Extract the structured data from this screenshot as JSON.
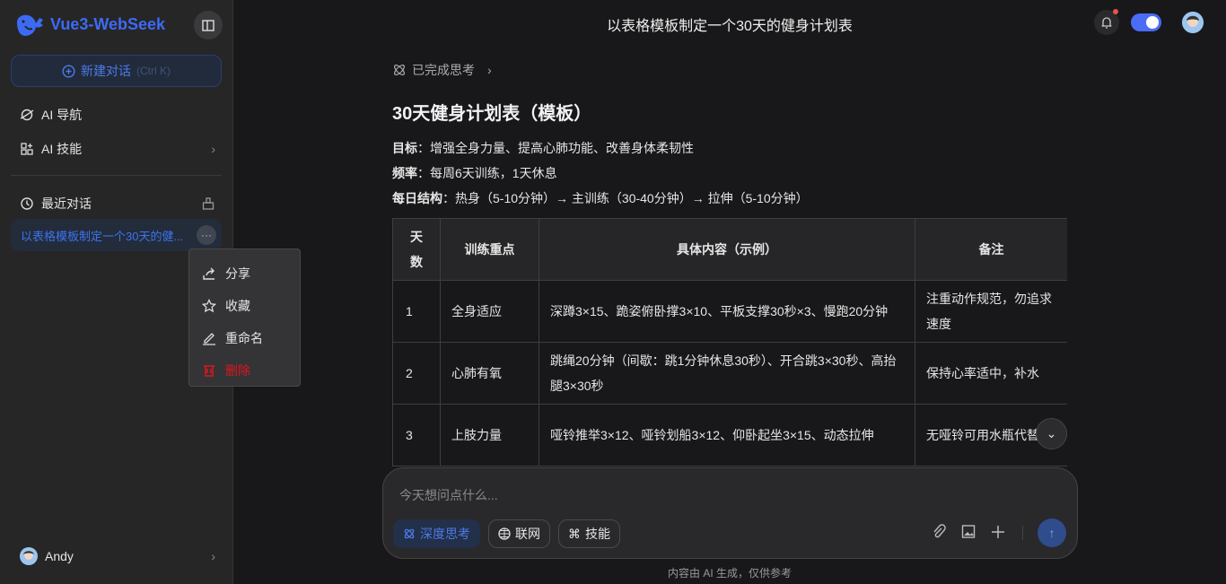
{
  "app": {
    "name": "Vue3-WebSeek",
    "brand_color": "#3d6af5"
  },
  "sidebar": {
    "new_chat": {
      "label": "新建对话",
      "shortcut": "(Ctrl K)"
    },
    "nav": [
      {
        "label": "AI 导航",
        "icon": "planet-icon"
      },
      {
        "label": "AI 技能",
        "icon": "apps-icon"
      }
    ],
    "recent_label": "最近对话",
    "conversations": [
      {
        "title": "以表格模板制定一个30天的健...",
        "active": true
      }
    ],
    "context_menu": [
      {
        "label": "分享",
        "icon": "share-icon"
      },
      {
        "label": "收藏",
        "icon": "star-icon"
      },
      {
        "label": "重命名",
        "icon": "edit-icon"
      },
      {
        "label": "删除",
        "icon": "trash-icon",
        "danger": true
      }
    ],
    "user": {
      "name": "Andy"
    }
  },
  "header": {
    "title": "以表格模板制定一个30天的健身计划表",
    "notification_dot": true,
    "dark_mode": true
  },
  "message": {
    "thinking_label": "已完成思考",
    "heading": "30天健身计划表（模板）",
    "lines": [
      {
        "label": "目标",
        "text": "：增强全身力量、提高心肺功能、改善身体柔韧性"
      },
      {
        "label": "频率",
        "text": "：每周6天训练，1天休息"
      },
      {
        "label": "每日结构",
        "text": "：热身（5-10分钟）→ 主训练（30-40分钟）→ 拉伸（5-10分钟）"
      }
    ],
    "table": {
      "headers": [
        "天数",
        "训练重点",
        "具体内容（示例）",
        "备注"
      ],
      "rows": [
        [
          "1",
          "全身适应",
          "深蹲3×15、跪姿俯卧撑3×10、平板支撑30秒×3、慢跑20分钟",
          "注重动作规范，勿追求速度"
        ],
        [
          "2",
          "心肺有氧",
          "跳绳20分钟（间歇：跳1分钟休息30秒）、开合跳3×30秒、高抬腿3×30秒",
          "保持心率适中，补水"
        ],
        [
          "3",
          "上肢力量",
          "哑铃推举3×12、哑铃划船3×12、仰卧起坐3×15、动态拉伸",
          "无哑铃可用水瓶代替"
        ],
        [
          "",
          "",
          "",
          ""
        ]
      ]
    }
  },
  "composer": {
    "placeholder": "今天想问点什么...",
    "buttons": [
      {
        "label": "深度思考",
        "active": true
      },
      {
        "label": "联网"
      },
      {
        "label": "技能"
      }
    ]
  },
  "footer": "内容由 AI 生成，仅供参考"
}
